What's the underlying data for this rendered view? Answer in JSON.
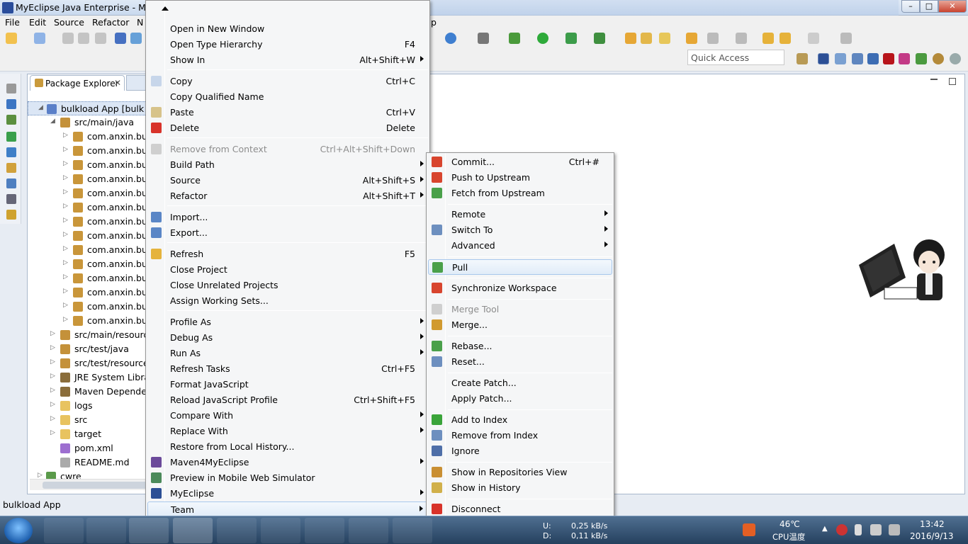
{
  "window": {
    "title": "MyEclipse Java Enterprise - MyE"
  },
  "menubar": {
    "file": "File",
    "edit": "Edit",
    "source": "Source",
    "refactor": "Refactor",
    "n": "N",
    "p": "p"
  },
  "quick_access": {
    "placeholder": "Quick Access"
  },
  "package_explorer": {
    "tab_label": "Package Explorer",
    "close": "✕",
    "rows": [
      {
        "label": "bulkload App  [bulk"
      },
      {
        "label": "src/main/java"
      },
      {
        "label": "com.anxin.bull"
      },
      {
        "label": "com.anxin.bull"
      },
      {
        "label": "com.anxin.bull"
      },
      {
        "label": "com.anxin.bull"
      },
      {
        "label": "com.anxin.bull"
      },
      {
        "label": "com.anxin.bull"
      },
      {
        "label": "com.anxin.bull"
      },
      {
        "label": "com.anxin.bull"
      },
      {
        "label": "com.anxin.bull"
      },
      {
        "label": "com.anxin.bull"
      },
      {
        "label": "com.anxin.bull"
      },
      {
        "label": "com.anxin.bull"
      },
      {
        "label": "com.anxin.bull"
      },
      {
        "label": "com.anxin.bull"
      },
      {
        "label": "src/main/resourc"
      },
      {
        "label": "src/test/java"
      },
      {
        "label": "src/test/resource"
      },
      {
        "label": "JRE System Librar"
      },
      {
        "label": "Maven Depender"
      },
      {
        "label": "logs"
      },
      {
        "label": "src"
      },
      {
        "label": "target"
      },
      {
        "label": "pom.xml"
      },
      {
        "label": "README.md"
      },
      {
        "label": "cwre"
      }
    ]
  },
  "status": {
    "text": "bulkload App"
  },
  "context_menu": {
    "items": [
      {
        "label": "Open in New Window",
        "shortcut": ""
      },
      {
        "label": "Open Type Hierarchy",
        "shortcut": "F4"
      },
      {
        "label": "Show In",
        "shortcut": "Alt+Shift+W"
      },
      {
        "label": "Copy",
        "shortcut": "Ctrl+C"
      },
      {
        "label": "Copy Qualified Name",
        "shortcut": ""
      },
      {
        "label": "Paste",
        "shortcut": "Ctrl+V"
      },
      {
        "label": "Delete",
        "shortcut": "Delete"
      },
      {
        "label": "Remove from Context",
        "shortcut": "Ctrl+Alt+Shift+Down"
      },
      {
        "label": "Build Path",
        "shortcut": ""
      },
      {
        "label": "Source",
        "shortcut": "Alt+Shift+S"
      },
      {
        "label": "Refactor",
        "shortcut": "Alt+Shift+T"
      },
      {
        "label": "Import...",
        "shortcut": ""
      },
      {
        "label": "Export...",
        "shortcut": ""
      },
      {
        "label": "Refresh",
        "shortcut": "F5"
      },
      {
        "label": "Close Project",
        "shortcut": ""
      },
      {
        "label": "Close Unrelated Projects",
        "shortcut": ""
      },
      {
        "label": "Assign Working Sets...",
        "shortcut": ""
      },
      {
        "label": "Profile As",
        "shortcut": ""
      },
      {
        "label": "Debug As",
        "shortcut": ""
      },
      {
        "label": "Run As",
        "shortcut": ""
      },
      {
        "label": "Refresh Tasks",
        "shortcut": "Ctrl+F5"
      },
      {
        "label": "Format JavaScript",
        "shortcut": ""
      },
      {
        "label": "Reload JavaScript Profile",
        "shortcut": "Ctrl+Shift+F5"
      },
      {
        "label": "Compare With",
        "shortcut": ""
      },
      {
        "label": "Replace With",
        "shortcut": ""
      },
      {
        "label": "Restore from Local History...",
        "shortcut": ""
      },
      {
        "label": "Maven4MyEclipse",
        "shortcut": ""
      },
      {
        "label": "Preview in Mobile Web Simulator",
        "shortcut": ""
      },
      {
        "label": "MyEclipse",
        "shortcut": ""
      },
      {
        "label": "Team",
        "shortcut": ""
      }
    ]
  },
  "team_submenu": {
    "items": [
      {
        "label": "Commit...",
        "shortcut": "Ctrl+#"
      },
      {
        "label": "Push to Upstream",
        "shortcut": ""
      },
      {
        "label": "Fetch from Upstream",
        "shortcut": ""
      },
      {
        "label": "Remote",
        "shortcut": ""
      },
      {
        "label": "Switch To",
        "shortcut": ""
      },
      {
        "label": "Advanced",
        "shortcut": ""
      },
      {
        "label": "Pull",
        "shortcut": ""
      },
      {
        "label": "Synchronize Workspace",
        "shortcut": ""
      },
      {
        "label": "Merge Tool",
        "shortcut": ""
      },
      {
        "label": "Merge...",
        "shortcut": ""
      },
      {
        "label": "Rebase...",
        "shortcut": ""
      },
      {
        "label": "Reset...",
        "shortcut": ""
      },
      {
        "label": "Create Patch...",
        "shortcut": ""
      },
      {
        "label": "Apply Patch...",
        "shortcut": ""
      },
      {
        "label": "Add to Index",
        "shortcut": ""
      },
      {
        "label": "Remove from Index",
        "shortcut": ""
      },
      {
        "label": "Ignore",
        "shortcut": ""
      },
      {
        "label": "Show in Repositories View",
        "shortcut": ""
      },
      {
        "label": "Show in History",
        "shortcut": ""
      },
      {
        "label": "Disconnect",
        "shortcut": ""
      }
    ]
  },
  "taskbar": {
    "net_u_label": "U:",
    "net_u_value": "0,25 kB/s",
    "net_d_label": "D:",
    "net_d_value": "0,11 kB/s",
    "cpu_temp": "46℃",
    "cpu_label": "CPU温度",
    "time": "13:42",
    "date": "2016/9/13"
  },
  "colors": {
    "menu_highlight_border": "#a8c8ec",
    "selection": "#dbe6f5",
    "taskbar": "#25405e"
  }
}
